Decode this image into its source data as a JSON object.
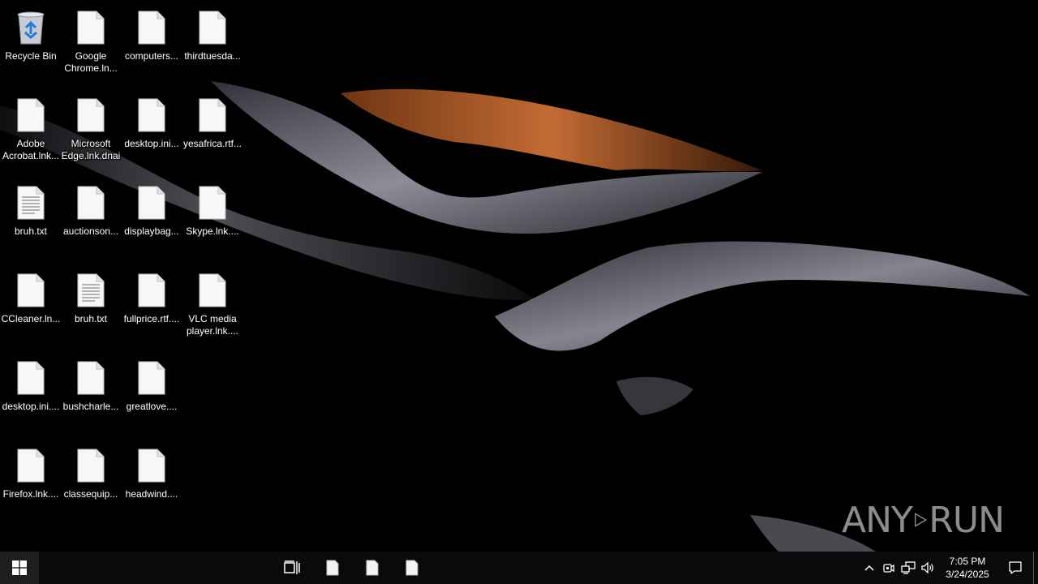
{
  "desktop": {
    "icons": [
      {
        "label": "Recycle Bin",
        "icon": "recycle-bin-icon"
      },
      {
        "label": "Google\nChrome.ln...",
        "icon": "file-icon"
      },
      {
        "label": "computers...",
        "icon": "file-icon"
      },
      {
        "label": "thirdtuesda...",
        "icon": "file-icon"
      },
      {
        "label": "Adobe\nAcrobat.lnk...",
        "icon": "file-icon"
      },
      {
        "label": "Microsoft\nEdge.lnk.dnai",
        "icon": "file-icon"
      },
      {
        "label": "desktop.ini...",
        "icon": "file-icon"
      },
      {
        "label": "yesafrica.rtf...",
        "icon": "file-icon"
      },
      {
        "label": "bruh.txt",
        "icon": "text-file-icon"
      },
      {
        "label": "auctionson...",
        "icon": "file-icon"
      },
      {
        "label": "displaybag...",
        "icon": "file-icon"
      },
      {
        "label": "Skype.lnk....",
        "icon": "file-icon"
      },
      {
        "label": "CCleaner.ln...",
        "icon": "file-icon"
      },
      {
        "label": "bruh.txt",
        "icon": "text-file-icon"
      },
      {
        "label": "fullprice.rtf....",
        "icon": "file-icon"
      },
      {
        "label": "VLC media\nplayer.lnk....",
        "icon": "file-icon"
      },
      {
        "label": "desktop.ini....",
        "icon": "file-icon"
      },
      {
        "label": "bushcharle...",
        "icon": "file-icon"
      },
      {
        "label": "greatlove....",
        "icon": "file-icon"
      },
      {
        "label": "Firefox.lnk....",
        "icon": "file-icon"
      },
      {
        "label": "classequip...",
        "icon": "file-icon"
      },
      {
        "label": "headwind....",
        "icon": "file-icon"
      }
    ]
  },
  "watermark": {
    "left": "ANY",
    "right": "RUN"
  },
  "taskbar": {
    "start_icon": "windows-logo-icon",
    "task_view_icon": "task-view-icon",
    "pinned": [
      "file-icon",
      "file-icon",
      "file-icon"
    ],
    "tray": {
      "icons": [
        "chevron-up-icon",
        "meet-now-icon",
        "network-icon",
        "volume-icon"
      ],
      "time": "7:05 PM",
      "date": "3/24/2025",
      "notification_icon": "action-center-icon"
    }
  }
}
